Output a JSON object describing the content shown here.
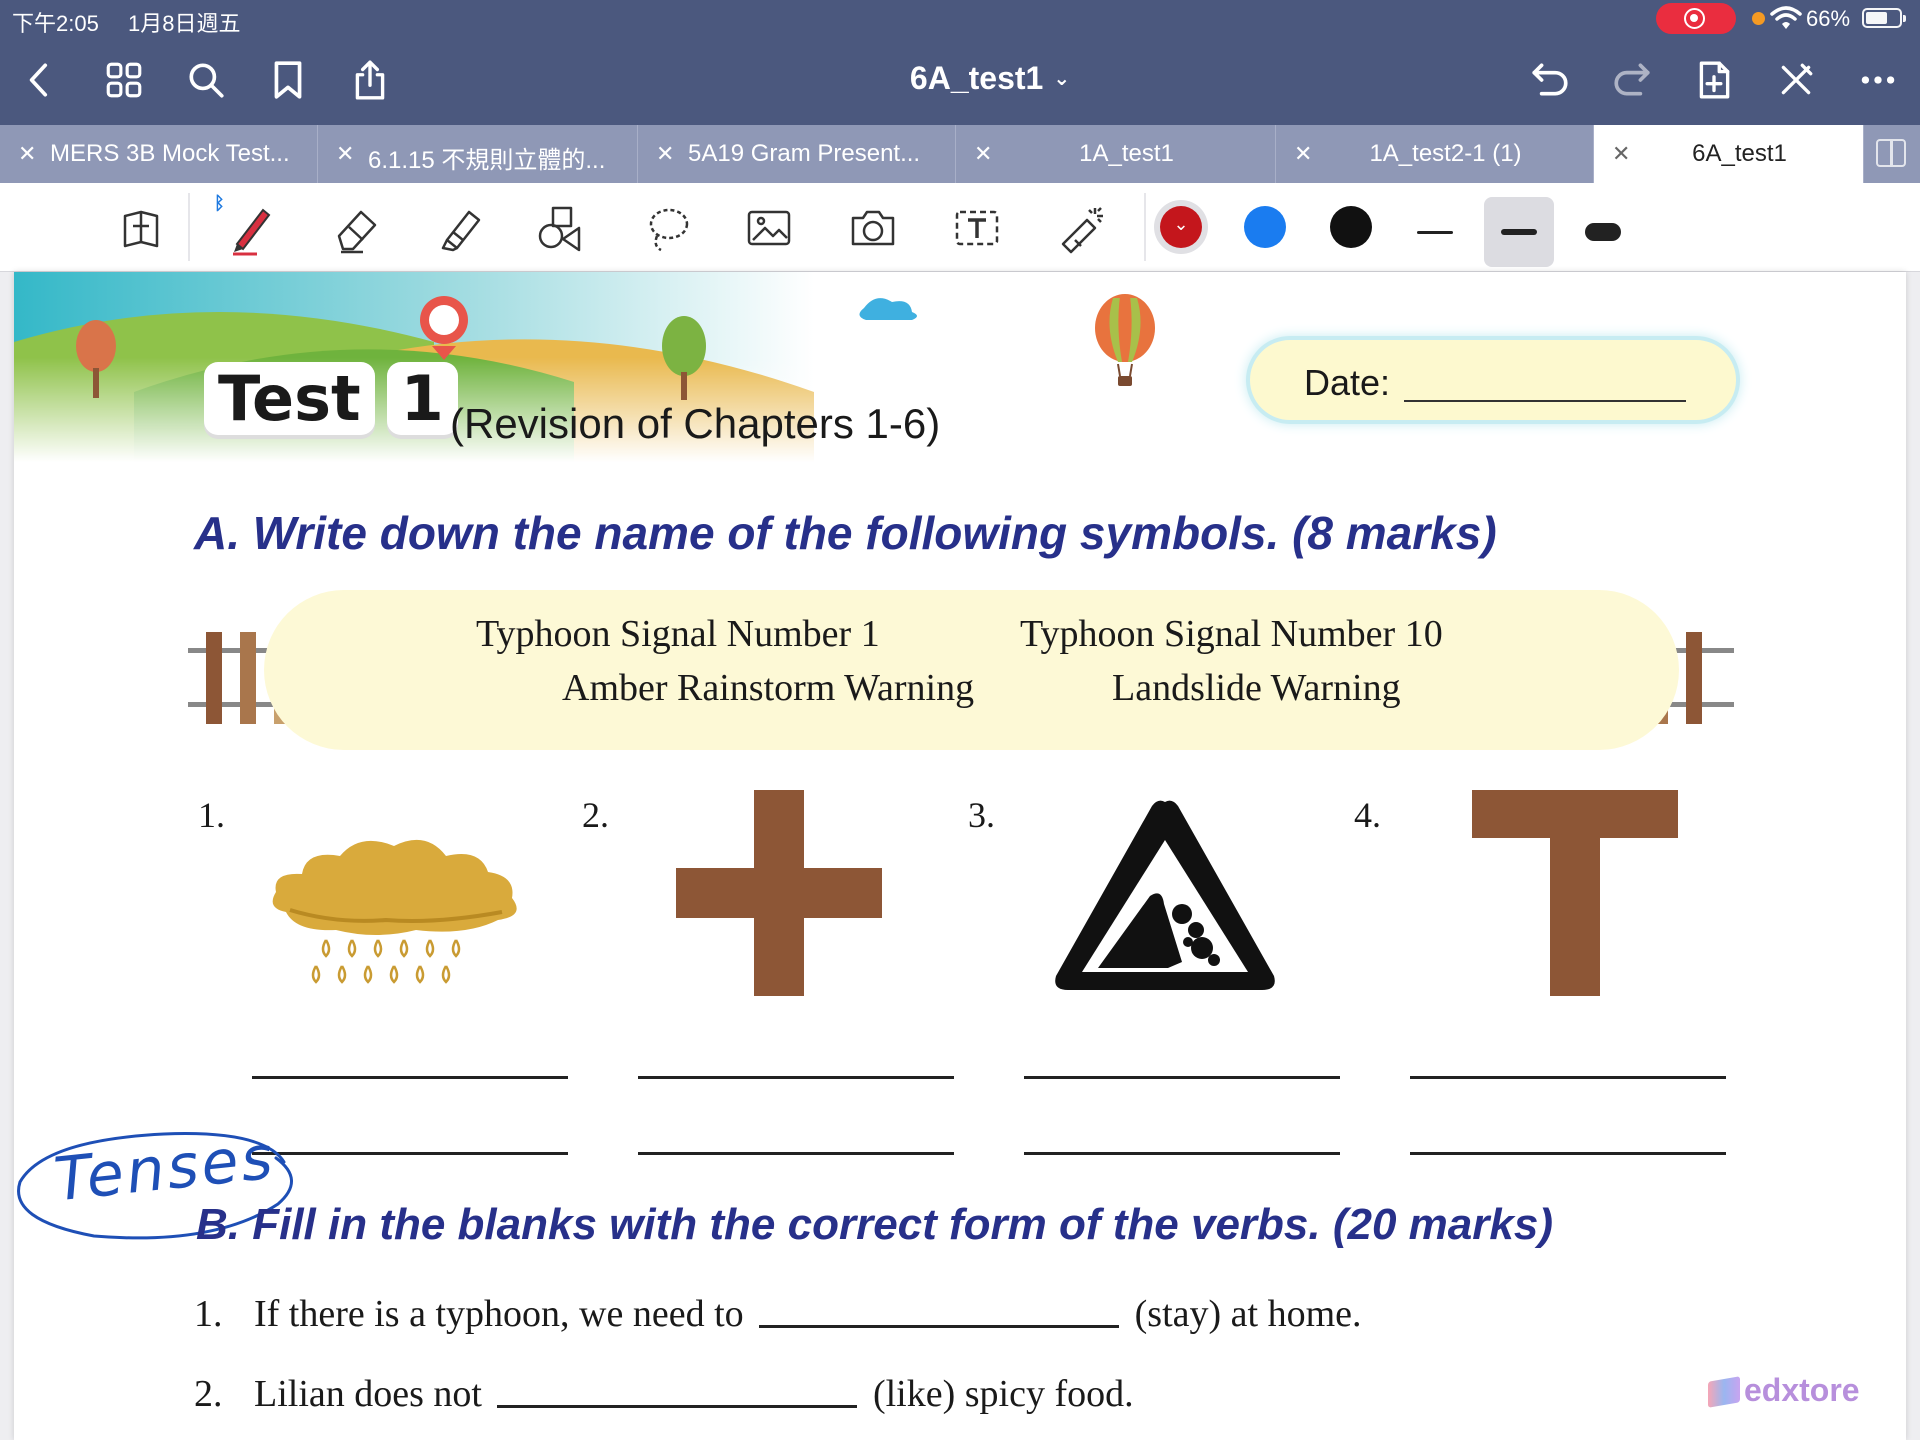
{
  "status_bar": {
    "time": "下午2:05",
    "date": "1月8日週五",
    "battery": "66%",
    "battery_level": 0.66,
    "recording_color": "#ea2d3f"
  },
  "nav": {
    "title": "6A_test1",
    "left_icons": [
      "back-chevron-icon",
      "grid-view-icon",
      "search-icon",
      "bookmark-icon",
      "share-icon"
    ],
    "right_icons": [
      "undo-icon",
      "redo-icon",
      "add-page-icon",
      "close-pen-icon",
      "more-icon"
    ]
  },
  "tabs": [
    {
      "label": "MERS 3B Mock Test...",
      "active": false
    },
    {
      "label": "6.1.15 不規則立體的...",
      "active": false
    },
    {
      "label": "5A19 Gram Present...",
      "active": false
    },
    {
      "label": "1A_test1",
      "active": false
    },
    {
      "label": "1A_test2-1 (1)",
      "active": false
    },
    {
      "label": "6A_test1",
      "active": true
    }
  ],
  "toolbar": {
    "tools": [
      "reading-mode-icon",
      "pen-icon",
      "eraser-icon",
      "highlighter-icon",
      "shapes-icon",
      "lasso-icon",
      "image-icon",
      "camera-icon",
      "text-box-icon",
      "laser-pointer-icon"
    ],
    "selected_tool": "pen-icon",
    "colors": [
      "#c4161c",
      "#1a7cf0",
      "#111111"
    ],
    "selected_color": "#c4161c",
    "stroke_widths": [
      "thin",
      "medium",
      "thick"
    ],
    "selected_stroke": "medium"
  },
  "worksheet": {
    "test_word": "Test",
    "test_number": "1",
    "subtitle": "(Revision of Chapters 1-6)",
    "date_label": "Date:",
    "section_a": "A. Write down the name of the following symbols. (8 marks)",
    "word_bank": [
      "Typhoon Signal Number 1",
      "Typhoon Signal Number 10",
      "Amber Rainstorm Warning",
      "Landslide Warning"
    ],
    "question_numbers": [
      "1.",
      "2.",
      "3.",
      "4."
    ],
    "annotation": "Tenses",
    "annotation_color": "#1e4fb6",
    "section_b": "B. Fill in the blanks with the correct form of the verbs. (20 marks)",
    "sentences": [
      {
        "num": "1.",
        "before": "If there is a typhoon, we need to",
        "after": "(stay) at home."
      },
      {
        "num": "2.",
        "before": "Lilian does not",
        "after": "(like) spicy food."
      }
    ],
    "brand": "edxtore",
    "symbol_brown": "#8d5636",
    "amber": "#d9aa3c"
  }
}
